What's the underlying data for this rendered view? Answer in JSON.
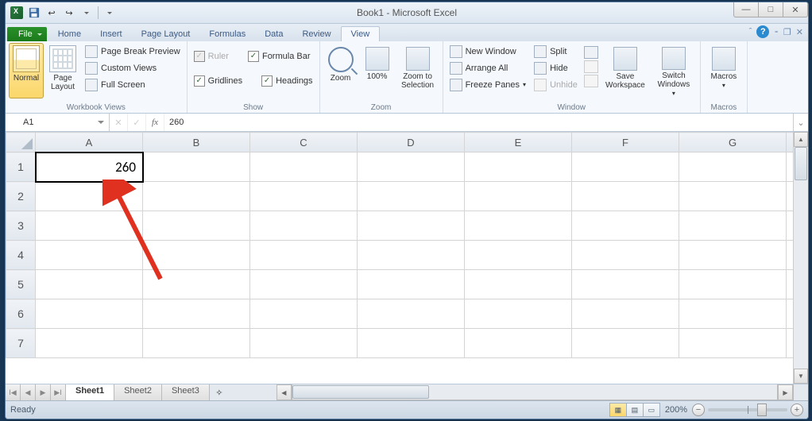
{
  "title": "Book1 - Microsoft Excel",
  "tabs": {
    "file": "File",
    "list": [
      "Home",
      "Insert",
      "Page Layout",
      "Formulas",
      "Data",
      "Review",
      "View"
    ],
    "active": "View"
  },
  "ribbon": {
    "workbook_views": {
      "normal": "Normal",
      "page_layout": "Page\nLayout",
      "page_break": "Page Break Preview",
      "custom": "Custom Views",
      "full": "Full Screen",
      "label": "Workbook Views"
    },
    "show": {
      "ruler": "Ruler",
      "gridlines": "Gridlines",
      "formula_bar": "Formula Bar",
      "headings": "Headings",
      "label": "Show"
    },
    "zoom": {
      "zoom": "Zoom",
      "hundred": "100%",
      "to_selection": "Zoom to\nSelection",
      "label": "Zoom"
    },
    "window": {
      "new_window": "New Window",
      "arrange": "Arrange All",
      "freeze": "Freeze Panes",
      "split": "Split",
      "hide": "Hide",
      "unhide": "Unhide",
      "save_ws": "Save\nWorkspace",
      "switch": "Switch\nWindows",
      "label": "Window"
    },
    "macros": {
      "macros": "Macros",
      "label": "Macros"
    }
  },
  "formula_bar": {
    "namebox": "A1",
    "fx": "fx",
    "value": "260"
  },
  "grid": {
    "cols": [
      "A",
      "B",
      "C",
      "D",
      "E",
      "F",
      "G"
    ],
    "rows": [
      "1",
      "2",
      "3",
      "4",
      "5",
      "6",
      "7"
    ],
    "cells": {
      "A1": "260"
    },
    "active": "A1"
  },
  "sheets": {
    "list": [
      "Sheet1",
      "Sheet2",
      "Sheet3"
    ],
    "active": "Sheet1"
  },
  "status": {
    "ready": "Ready",
    "zoom": "200%"
  }
}
